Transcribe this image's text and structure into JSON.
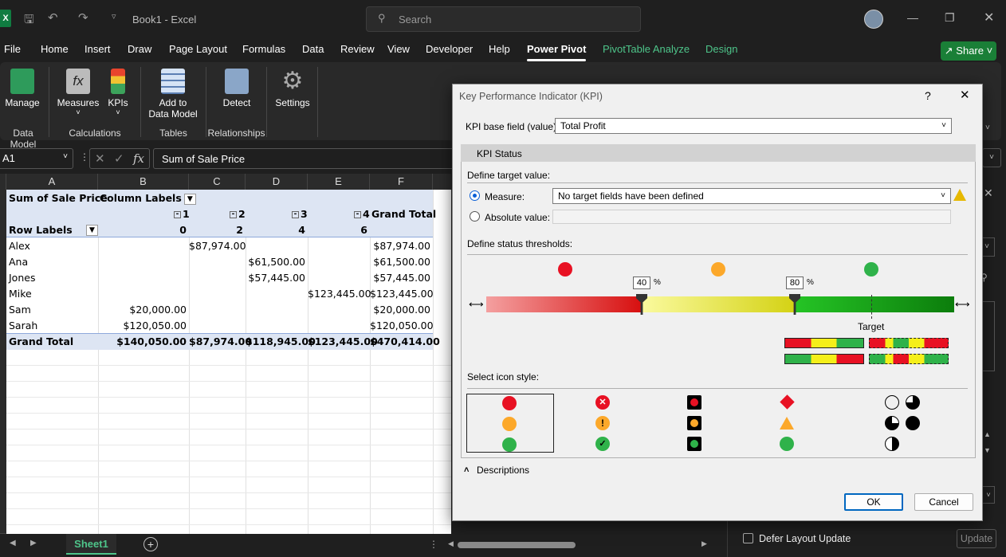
{
  "window": {
    "title": "Book1  -  Excel",
    "search_placeholder": "Search"
  },
  "menu": {
    "items": [
      "File",
      "Home",
      "Insert",
      "Draw",
      "Page Layout",
      "Formulas",
      "Data",
      "Review",
      "View",
      "Developer",
      "Help",
      "Power Pivot",
      "PivotTable Analyze",
      "Design"
    ],
    "active": "Power Pivot",
    "share": "Share"
  },
  "ribbon": {
    "buttons": {
      "manage": "Manage",
      "measures": "Measures",
      "kpis": "KPIs",
      "add_to": "Add to",
      "data_model": "Data Model",
      "detect": "Detect",
      "settings": "Settings"
    },
    "groups": {
      "data_model": "Data Model",
      "calculations": "Calculations",
      "tables": "Tables",
      "relationships": "Relationships"
    }
  },
  "formula_bar": {
    "name_box": "A1",
    "fx": "fx",
    "formula": "Sum of Sale Price"
  },
  "grid": {
    "columns": [
      "A",
      "B",
      "C",
      "D",
      "E",
      "F"
    ],
    "header1": {
      "a": "Sum of Sale Price",
      "b": "Column Labels"
    },
    "header2": {
      "c1": "1",
      "d1": "2",
      "e1": "3",
      "f1": "4",
      "g1": "Grand Total"
    },
    "header3": {
      "a": "Row Labels",
      "c": "0",
      "d": "2",
      "e": "4",
      "f": "6"
    },
    "rows": [
      {
        "label": "Alex",
        "b": "",
        "c": "$87,974.00",
        "d": "",
        "e": "",
        "f": "$87,974.00"
      },
      {
        "label": "Ana",
        "b": "",
        "c": "",
        "d": "$61,500.00",
        "e": "",
        "f": "$61,500.00"
      },
      {
        "label": "Jones",
        "b": "",
        "c": "",
        "d": "$57,445.00",
        "e": "",
        "f": "$57,445.00"
      },
      {
        "label": "Mike",
        "b": "",
        "c": "",
        "d": "",
        "e": "$123,445.00",
        "f": "$123,445.00"
      },
      {
        "label": "Sam",
        "b": "$20,000.00",
        "c": "",
        "d": "",
        "e": "",
        "f": "$20,000.00"
      },
      {
        "label": "Sarah",
        "b": "$120,050.00",
        "c": "",
        "d": "",
        "e": "",
        "f": "$120,050.00"
      }
    ],
    "total": {
      "label": "Grand Total",
      "b": "$140,050.00",
      "c": "$87,974.00",
      "d": "$118,945.00",
      "e": "$123,445.00",
      "f": "$470,414.00"
    }
  },
  "sheet": {
    "tab": "Sheet1"
  },
  "right_pane": {
    "defer_label": "Defer Layout Update",
    "update": "Update"
  },
  "dialog": {
    "title": "Key Performance Indicator (KPI)",
    "help": "?",
    "base_field_label": "KPI base field (value):",
    "base_field_value": "Total Profit",
    "status_header": "KPI Status",
    "target_label": "Define target value:",
    "measure_label": "Measure:",
    "measure_value": "No target fields have been defined",
    "absolute_label": "Absolute value:",
    "thresholds_label": "Define status thresholds:",
    "threshold_low": "40",
    "threshold_high": "80",
    "percent": "%",
    "target_marker": "Target",
    "icon_style_label": "Select icon style:",
    "descriptions": "Descriptions",
    "ok": "OK",
    "cancel": "Cancel",
    "colors": {
      "red": "#e81123",
      "yellow": "#fca82a",
      "green": "#2fb24a",
      "accent": "#0067c0"
    }
  }
}
